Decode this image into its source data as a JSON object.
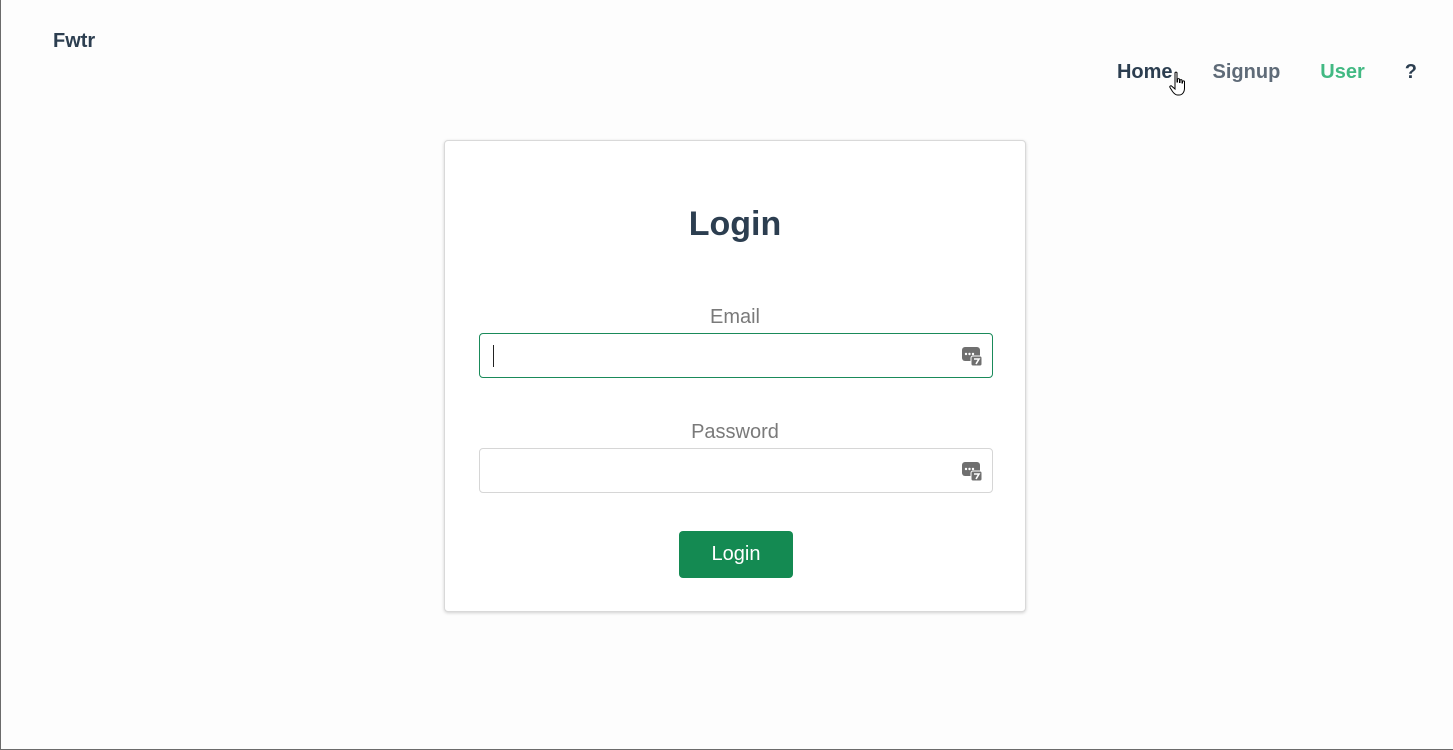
{
  "header": {
    "brand": "Fwtr",
    "nav": {
      "home": "Home",
      "signup": "Signup",
      "user": "User",
      "help": "?"
    }
  },
  "login_card": {
    "title": "Login",
    "email_label": "Email",
    "email_value": "",
    "password_label": "Password",
    "password_value": "",
    "submit_label": "Login"
  },
  "colors": {
    "accent": "#148a52",
    "active_nav": "#42b983",
    "text_dark": "#2c3e50"
  },
  "icons": {
    "field_icon": "password-manager-icon",
    "cursor": "hand-pointer-cursor"
  }
}
